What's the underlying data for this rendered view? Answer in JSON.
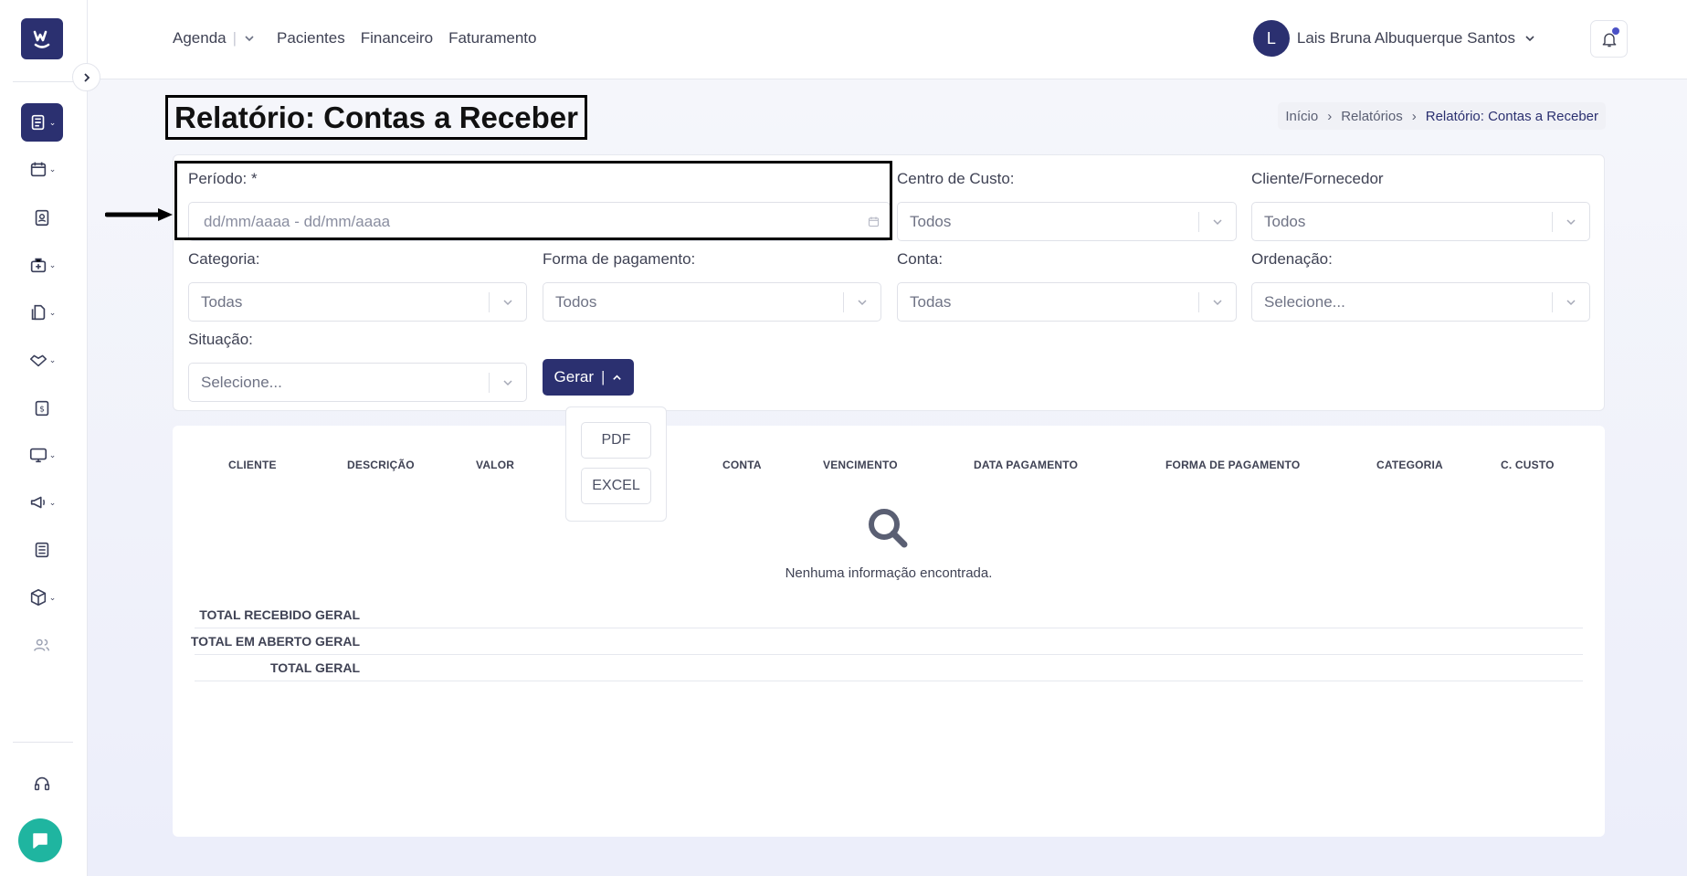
{
  "nav": {
    "agenda": "Agenda",
    "pacientes": "Pacientes",
    "financeiro": "Financeiro",
    "faturamento": "Faturamento"
  },
  "user": {
    "initial": "L",
    "name": "Lais Bruna Albuquerque Santos"
  },
  "logo_letter": "W",
  "page_title": "Relatório: Contas a Receber",
  "breadcrumb": {
    "home": "Início",
    "reports": "Relatórios",
    "current": "Relatório: Contas a Receber"
  },
  "filters": {
    "periodo": {
      "label": "Período: *",
      "placeholder": "dd/mm/aaaa - dd/mm/aaaa"
    },
    "centro_custo": {
      "label": "Centro de Custo:",
      "value": "Todos"
    },
    "cliente_fornecedor": {
      "label": "Cliente/Fornecedor",
      "value": "Todos"
    },
    "categoria": {
      "label": "Categoria:",
      "value": "Todas"
    },
    "forma_pagamento": {
      "label": "Forma de pagamento:",
      "value": "Todos"
    },
    "conta": {
      "label": "Conta:",
      "value": "Todas"
    },
    "ordenacao": {
      "label": "Ordenação:",
      "value": "Selecione..."
    },
    "situacao": {
      "label": "Situação:",
      "value": "Selecione..."
    }
  },
  "generate": {
    "label": "Gerar",
    "options": [
      "PDF",
      "EXCEL"
    ]
  },
  "table": {
    "headers": [
      "CLIENTE",
      "DESCRIÇÃO",
      "VALOR",
      "CONTA",
      "VENCIMENTO",
      "DATA PAGAMENTO",
      "FORMA DE PAGAMENTO",
      "CATEGORIA",
      "C. CUSTO"
    ],
    "empty_message": "Nenhuma informação encontrada.",
    "totals": [
      "TOTAL RECEBIDO GERAL",
      "TOTAL EM ABERTO GERAL",
      "TOTAL GERAL"
    ]
  },
  "icons": [
    "reports-icon",
    "calendar-icon",
    "patient-badge-icon",
    "medical-case-icon",
    "documents-icon",
    "handshake-icon",
    "dollar-icon",
    "monitor-icon",
    "megaphone-icon",
    "news-icon",
    "package-icon",
    "users-icon",
    "headset-icon",
    "chat-icon",
    "bell-icon",
    "search-icon"
  ],
  "colors": {
    "primary": "#2b3070",
    "chat": "#1fb5a0",
    "notification_dot": "#4b51c6"
  }
}
